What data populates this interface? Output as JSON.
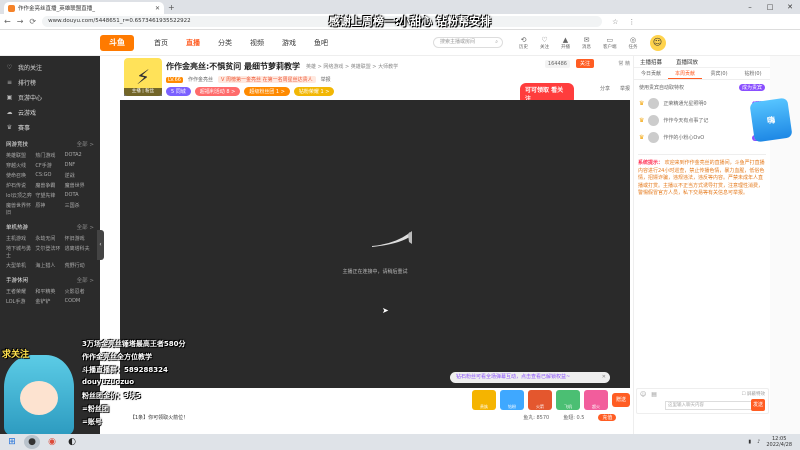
{
  "browser": {
    "tab_title": "作作金亮丝直播_英雄联盟直播_",
    "url": "www.douyu.com/5448651_r=0.6573461935522922"
  },
  "banner_text": "感谢上周榜一:小甜心  钻粉帮安排",
  "topnav": {
    "logo": "斗鱼",
    "items": [
      "首页",
      "直播",
      "分类",
      "视频",
      "游戏",
      "鱼吧"
    ],
    "active": "直播",
    "search_placeholder": "搜索主播或房间",
    "icons": [
      {
        "name": "history",
        "label": "历史",
        "glyph": "⟲"
      },
      {
        "name": "follow",
        "label": "关注",
        "glyph": "♡"
      },
      {
        "name": "upload",
        "label": "开播",
        "glyph": "▲"
      },
      {
        "name": "message",
        "label": "消息",
        "glyph": "✉"
      },
      {
        "name": "app",
        "label": "客户端",
        "glyph": "▭"
      },
      {
        "name": "task",
        "label": "任务",
        "glyph": "◎"
      }
    ]
  },
  "sidebar": {
    "top_items": [
      {
        "label": "我的关注",
        "icon": "♡"
      },
      {
        "label": "排行榜",
        "icon": "≡"
      },
      {
        "label": "页游中心",
        "icon": "▣"
      },
      {
        "label": "云游戏",
        "icon": "☁"
      },
      {
        "label": "赛事",
        "icon": "♛"
      }
    ],
    "sections": [
      {
        "title": "网游竞技",
        "more": "全部 >",
        "items": [
          "英雄联盟",
          "热门游戏",
          "DOTA2",
          "穿越火线",
          "CF手游",
          "DNF",
          "使命召唤",
          "CS:GO",
          "逆战",
          "炉石传说",
          "魔兽争霸",
          "魔兽世界",
          "lol云顶之弈",
          "守望先锋",
          "DOTA",
          "魔兽世界怀旧",
          "原神",
          "三国杀"
        ]
      },
      {
        "title": "单机热游",
        "more": "全部 >",
        "items": [
          "主机游戏",
          "永劫无间",
          "怀旧游戏",
          "地下城与勇士",
          "艾尔登法环",
          "逃离塔科夫",
          "大型单机",
          "海上猎人",
          "荒野行动"
        ]
      },
      {
        "title": "手游休闲",
        "more": "全部 >",
        "items": [
          "王者荣耀",
          "和平精英",
          "火影忍者",
          "LOL手游",
          "金铲铲",
          "CODM"
        ]
      }
    ]
  },
  "streamer": {
    "title": "作作金亮丝:不惧贫问 最细节萝莉教学",
    "categories": [
      "英雄",
      "网络游戏",
      "英雄联盟",
      "大师教学"
    ],
    "level": "LV.66",
    "name": "作作金亮丝",
    "noble_text": "V 周榜第一金亮丝 在第一名周星丝达贵人",
    "report_label": "举报",
    "follow_count": "164486",
    "follow_label": "关注",
    "room_tags": [
      "5 同城",
      "超福利活动 8 >",
      "超级粉丝团 1 >",
      "钻粉荣耀 1 >"
    ],
    "earn_label": "可可领取  看关注",
    "share_label": "分享",
    "report2_label": "举报",
    "avatar_tag": "主播 | 粉丝",
    "right_label": "常 精"
  },
  "player": {
    "connecting_text": "主播正在连接中，请稍后重试",
    "toast": "钻石粉丝可看全场弹幕互动，点击查看已解锁权益~"
  },
  "gifts": [
    {
      "label": "贵族",
      "color": "#f5b400"
    },
    {
      "label": "钻粉",
      "color": "#3fa8ff"
    },
    {
      "label": "火箭",
      "color": "#e4572e"
    },
    {
      "label": "飞机",
      "color": "#4bbf73"
    },
    {
      "label": "超火",
      "color": "#f25d9c"
    }
  ],
  "gift_send_button": "赠送",
  "bottom_bar": {
    "rank_text": "【1条】你可领取火箭位！",
    "fish_balls": "鱼丸: 8570",
    "fish_wings": "鱼翅: 0.5",
    "recharge": "充值"
  },
  "chat": {
    "header": [
      "主播招募",
      "直播回放"
    ],
    "tabs": [
      "今日贡献",
      "本周贡献",
      "贵宾(0)",
      "钻粉(0)"
    ],
    "vip_line": "使用贵宾自动取特权",
    "vip_open": "成为贵宾",
    "vip_rows": [
      {
        "name": "正荣精通光星照明0",
        "badge": "钻粉"
      },
      {
        "name": "作作今天有点事了记",
        "badge": "钻粉"
      },
      {
        "name": "作作的小粉心OvO",
        "badge": "钻粉"
      }
    ],
    "system_label": "系统提示：",
    "system_msg": "欢迎来到作作金亮丝的直播间，斗鱼严打直播内容进行24小时巡查，禁止传播色情，暴力血腥，低俗色情，招嫖诈骗，违规违法，违反等内容。严禁未成年人直播或打赏。主播以不正当方式诱导打赏，注意理性消费，警惕假冒官方人员，私下交易等有关信息可举报。",
    "input_placeholder": "这里输入聊天内容",
    "send_label": "发送",
    "checkbox_label": "屏蔽特效"
  },
  "overlay": {
    "follow": "求关注",
    "line1": "3万场金亮丝锤塔最高王者580分",
    "line2": "作作金亮丝全方位教学",
    "line3": "斗播直播群：589288324",
    "line4": "douyuzuozuo",
    "line5": "粉丝团金价：9块5",
    "line6": "=粉丝团",
    "line7": "=账号"
  },
  "taskbar": {
    "time": "12:05",
    "date": "2022/4/28"
  },
  "colors": {
    "accent": "#ff5d23",
    "sidebar_bg": "#2b2b2b",
    "player_bg": "#2a2a2a",
    "purple": "#8a4fff"
  }
}
